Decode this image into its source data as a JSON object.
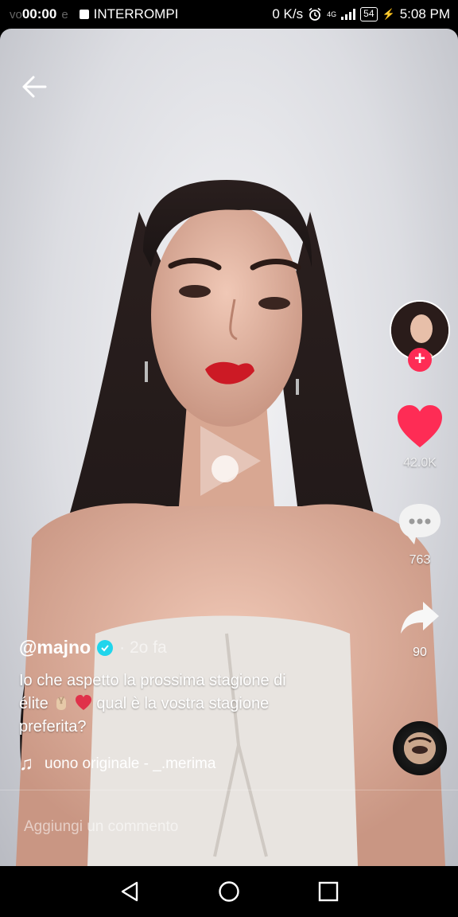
{
  "status_bar": {
    "ghost_left": "vo",
    "ghost_mid": "e",
    "timer": "00:00",
    "stop_label": "INTERROMPI",
    "net_speed": "0 K/s",
    "battery": "54",
    "clock": "5:08 PM",
    "network": "4G"
  },
  "video": {
    "back_icon": "arrow-left-icon",
    "play_icon": "play-icon"
  },
  "rail": {
    "like_count": "42.0K",
    "comment_count": "763",
    "share_count": "90",
    "like_color": "#fe2c55",
    "follow_badge": "+"
  },
  "caption": {
    "username": "@majno",
    "time_ago": "· 2o fa",
    "text_line1": "Io che aspetto la prossima stagione di",
    "text_line2_a": "élite",
    "text_line2_b": "qual è la vostra stagione",
    "text_line3": "preferita?",
    "music": "uono originale - _.merima"
  },
  "comment": {
    "placeholder": "Aggiungi un commento"
  },
  "nav": {
    "back": "nav-back-icon",
    "home": "nav-home-icon",
    "recents": "nav-recents-icon"
  }
}
